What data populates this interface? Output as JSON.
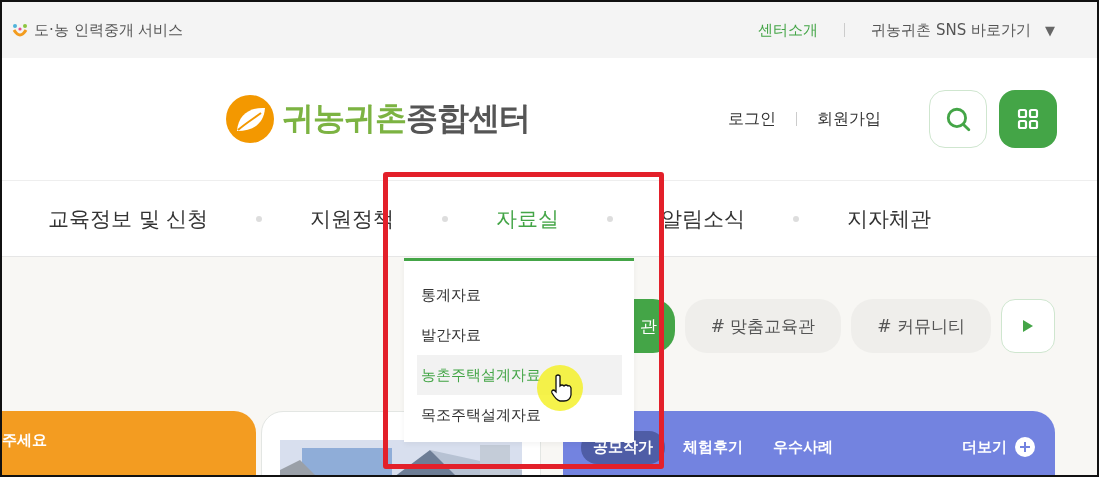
{
  "top_bar": {
    "service_link": "도·농 인력중개 서비스",
    "links": [
      {
        "label": "센터소개",
        "selected": true
      },
      {
        "label": "귀농귀촌 SNS 바로가기",
        "selected": false
      }
    ],
    "sns_caret": "▼"
  },
  "header": {
    "logo": {
      "green_text": "귀농귀촌",
      "gray_text": "종합센터"
    },
    "account_links": [
      "로그인",
      "회원가입"
    ]
  },
  "nav": [
    {
      "label": "교육정보 및 신청",
      "selected": false
    },
    {
      "label": "지원정책",
      "selected": false
    },
    {
      "label": "자료실",
      "selected": true
    },
    {
      "label": "알림소식",
      "selected": false
    },
    {
      "label": "지자체관",
      "selected": false
    }
  ],
  "dropdown": [
    {
      "label": "통계자료",
      "selected": false
    },
    {
      "label": "발간자료",
      "selected": false
    },
    {
      "label": "농촌주택설계자료",
      "selected": true
    },
    {
      "label": "목조주택설계자료",
      "selected": false
    }
  ],
  "tags": [
    {
      "label": "관",
      "selected": true
    },
    {
      "label": "# 맞춤교육관",
      "selected": false
    },
    {
      "label": "# 커뮤니티",
      "selected": false
    }
  ],
  "cards": {
    "notice_card": {
      "text": "주세요"
    },
    "board_card": {
      "tabs": [
        {
          "label": "공모작가",
          "selected": true
        },
        {
          "label": "체험후기",
          "selected": false
        },
        {
          "label": "우수사례",
          "selected": false
        }
      ],
      "more": "더보기"
    }
  }
}
